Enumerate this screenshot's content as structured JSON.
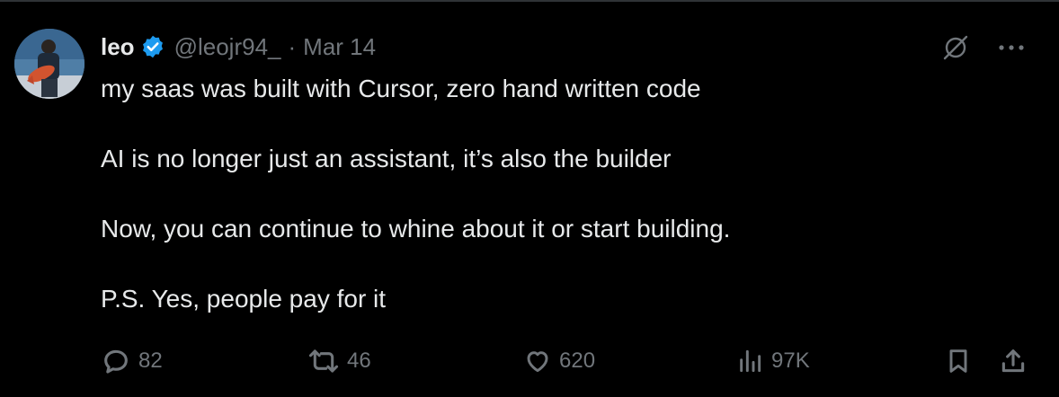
{
  "tweet": {
    "author": {
      "name": "leo",
      "handle": "@leojr94_",
      "separator": "·",
      "date": "Mar 14",
      "verified_color": "#1d9bf0"
    },
    "text": [
      "my saas was built with Cursor, zero hand written code",
      "AI is no longer just an assistant, it’s also the builder",
      "Now, you can continue to whine about it or start building.",
      "P.S. Yes, people pay for it"
    ],
    "top_icons": [
      "grok-icon",
      "more-icon"
    ],
    "metrics": {
      "replies": "82",
      "retweets": "46",
      "likes": "620",
      "views": "97K"
    }
  },
  "colors": {
    "background": "#000000",
    "text": "#e7e9ea",
    "muted": "#71767b",
    "accent": "#1d9bf0"
  }
}
